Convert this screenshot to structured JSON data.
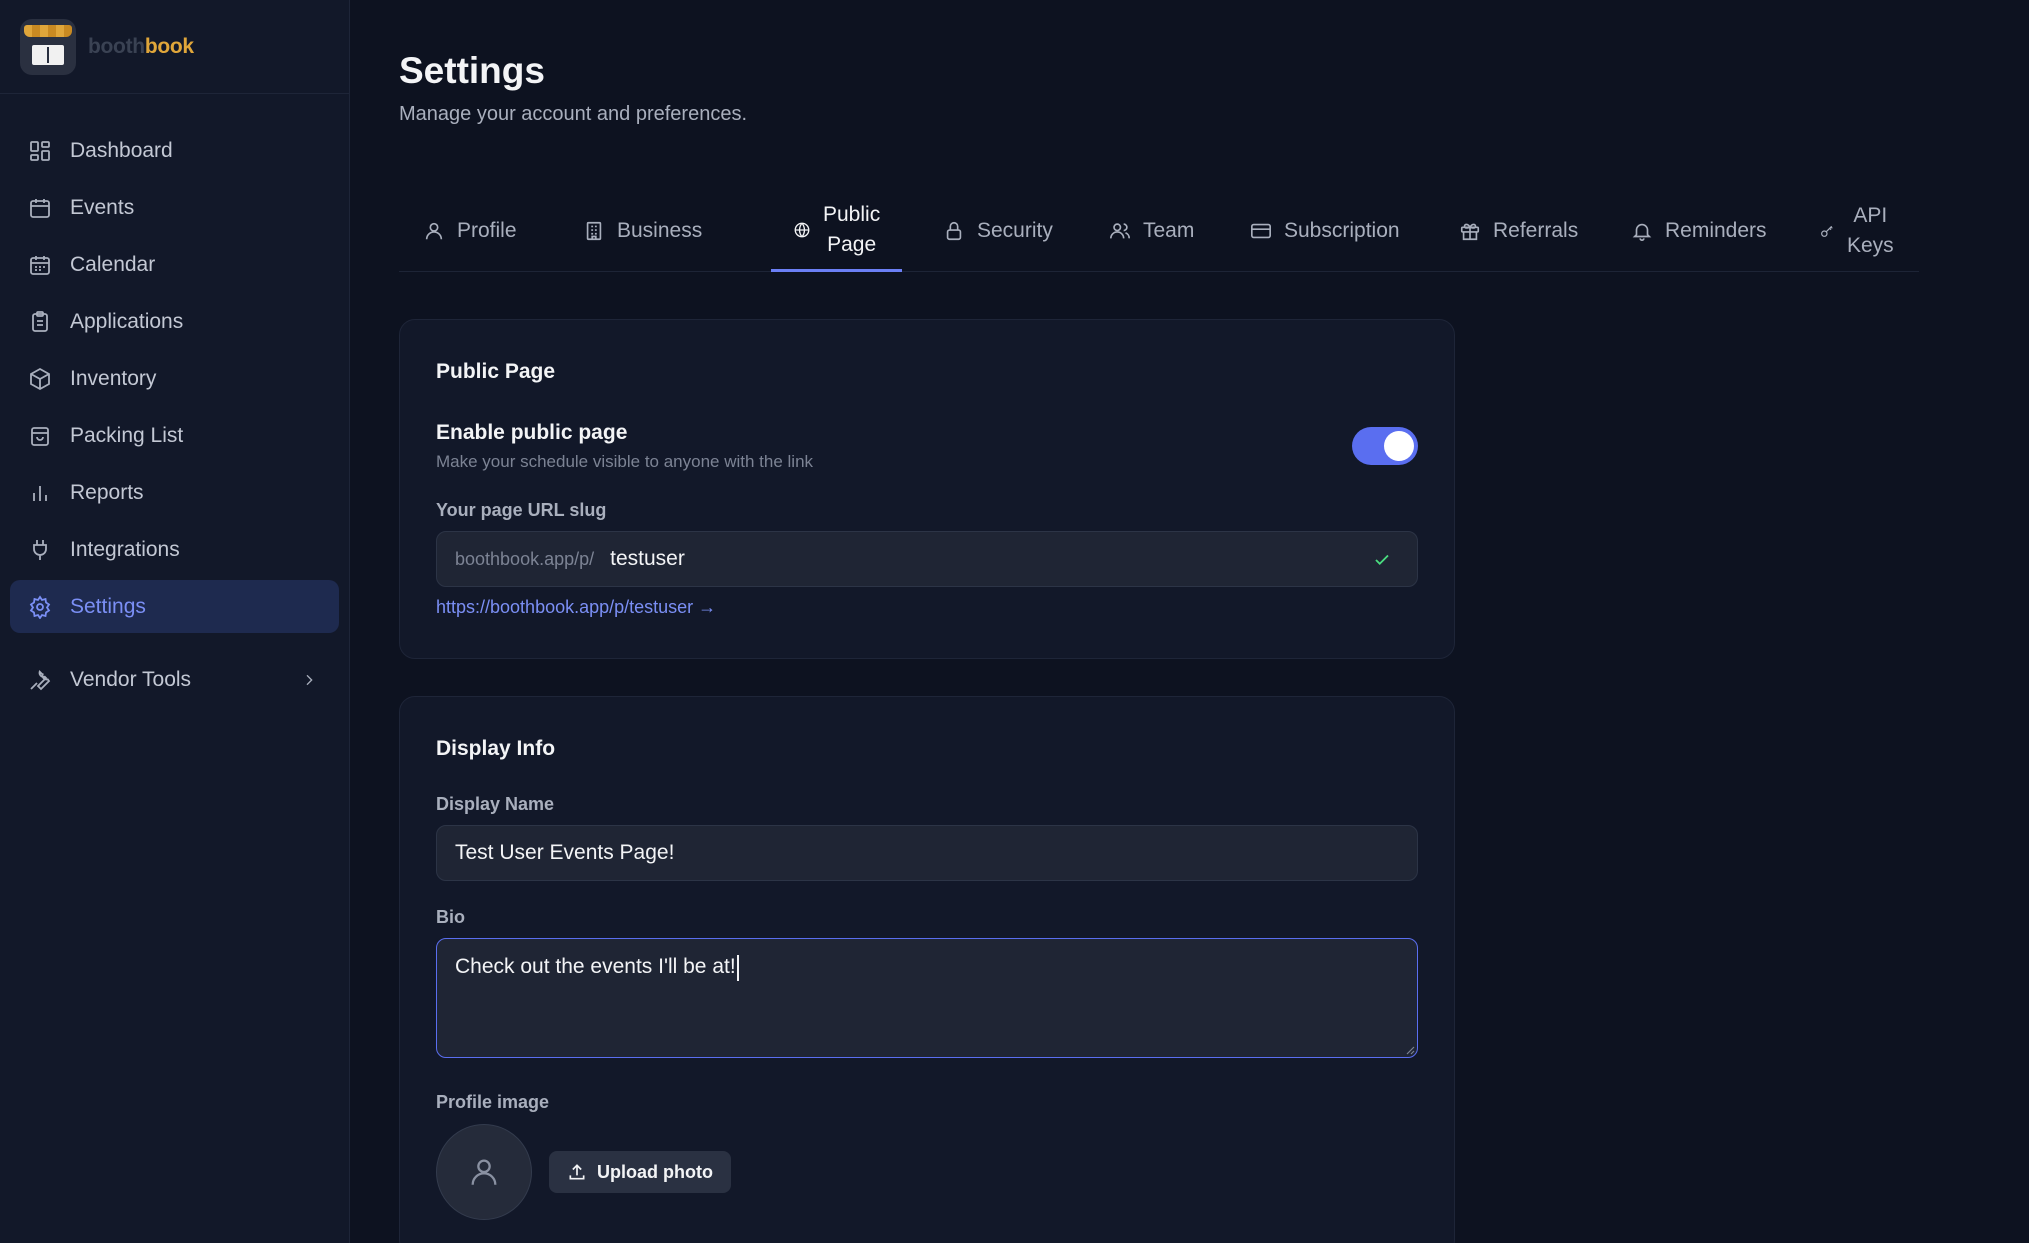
{
  "brand": {
    "name_part1": "booth",
    "name_part2": "book"
  },
  "sidebar": {
    "items": [
      {
        "label": "Dashboard",
        "icon": "dashboard-icon"
      },
      {
        "label": "Events",
        "icon": "calendar-icon"
      },
      {
        "label": "Calendar",
        "icon": "calendar-grid-icon"
      },
      {
        "label": "Applications",
        "icon": "clipboard-icon"
      },
      {
        "label": "Inventory",
        "icon": "box-icon"
      },
      {
        "label": "Packing List",
        "icon": "bag-icon"
      },
      {
        "label": "Reports",
        "icon": "bar-chart-icon"
      },
      {
        "label": "Integrations",
        "icon": "plug-icon"
      },
      {
        "label": "Settings",
        "icon": "gear-icon",
        "active": true
      }
    ],
    "vendor_tools": {
      "label": "Vendor Tools",
      "icon": "wrench-icon"
    }
  },
  "header": {
    "title": "Settings",
    "subtitle": "Manage your account and preferences."
  },
  "tabs": [
    {
      "label": "Profile",
      "icon": "user-icon"
    },
    {
      "label": "Business",
      "icon": "building-icon"
    },
    {
      "line1": "Public",
      "line2": "Page",
      "icon": "globe-icon",
      "active": true
    },
    {
      "label": "Security",
      "icon": "lock-icon"
    },
    {
      "label": "Team",
      "icon": "users-icon"
    },
    {
      "label": "Subscription",
      "icon": "credit-card-icon"
    },
    {
      "label": "Referrals",
      "icon": "gift-icon"
    },
    {
      "label": "Reminders",
      "icon": "bell-icon"
    },
    {
      "line1": "API",
      "line2": "Keys",
      "icon": "key-icon"
    }
  ],
  "public_page": {
    "title": "Public Page",
    "enable_label": "Enable public page",
    "enable_desc": "Make your schedule visible to anyone with the link",
    "enabled": true,
    "slug_label": "Your page URL slug",
    "slug_prefix": "boothbook.app/p/",
    "slug_value": "testuser",
    "link": "https://boothbook.app/p/testuser →"
  },
  "display_info": {
    "title": "Display Info",
    "display_name_label": "Display Name",
    "display_name_value": "Test User Events Page!",
    "bio_label": "Bio",
    "bio_value": "Check out the events I'll be at!",
    "profile_image_label": "Profile image",
    "upload_label": "Upload photo"
  },
  "colors": {
    "accent": "#5a6ef0",
    "background": "#0d1220",
    "card": "#121829",
    "brand_gold": "#e0a63a",
    "success": "#4ade80"
  }
}
